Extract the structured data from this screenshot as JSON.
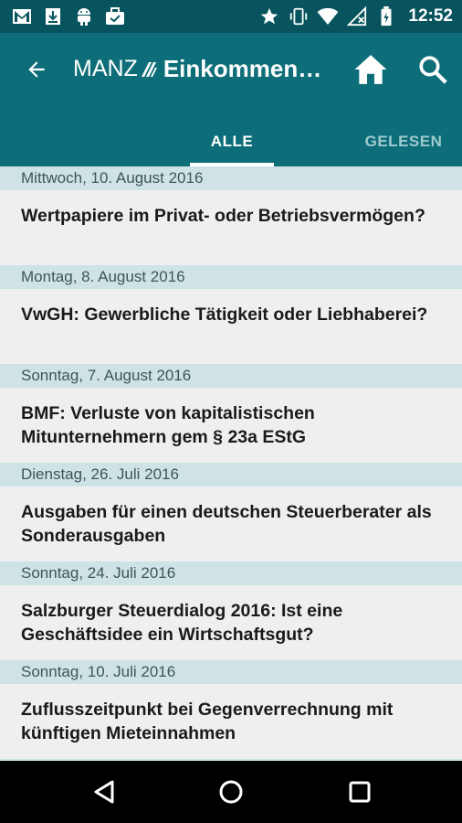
{
  "status_bar": {
    "time": "12:52",
    "left_icons": [
      "gmail-icon",
      "download-icon",
      "android-icon",
      "briefcase-check-icon"
    ],
    "right_icons": [
      "star-icon",
      "vibrate-icon",
      "wifi-icon",
      "no-signal-icon",
      "battery-charging-icon"
    ]
  },
  "app_bar": {
    "brand": "MANZ",
    "title": "Einkommen…",
    "background": "#0d6e79",
    "status_background": "#07545e"
  },
  "tabs": [
    {
      "label": "ALLE",
      "active": true
    },
    {
      "label": "GELESEN",
      "active": false
    }
  ],
  "articles": [
    {
      "date": "Mittwoch, 10. August 2016",
      "title": "Wertpapiere im Privat- oder Betriebsvermögen?"
    },
    {
      "date": "Montag, 8. August 2016",
      "title": "VwGH: Gewerbliche Tätigkeit oder Liebhaberei?"
    },
    {
      "date": "Sonntag, 7. August 2016",
      "title": "BMF: Verluste von kapitalistischen Mitunternehmern gem § 23a EStG"
    },
    {
      "date": "Dienstag, 26. Juli 2016",
      "title": "Ausgaben für einen deutschen Steuerberater als Sonderausgaben"
    },
    {
      "date": "Sonntag, 24. Juli 2016",
      "title": "Salzburger Steuerdialog 2016: Ist eine Geschäftsidee ein Wirtschaftsgut?"
    },
    {
      "date": "Sonntag, 10. Juli 2016",
      "title": "Zuflusszeitpunkt bei Gegenverrechnung mit künftigen Mieteinnahmen"
    }
  ]
}
